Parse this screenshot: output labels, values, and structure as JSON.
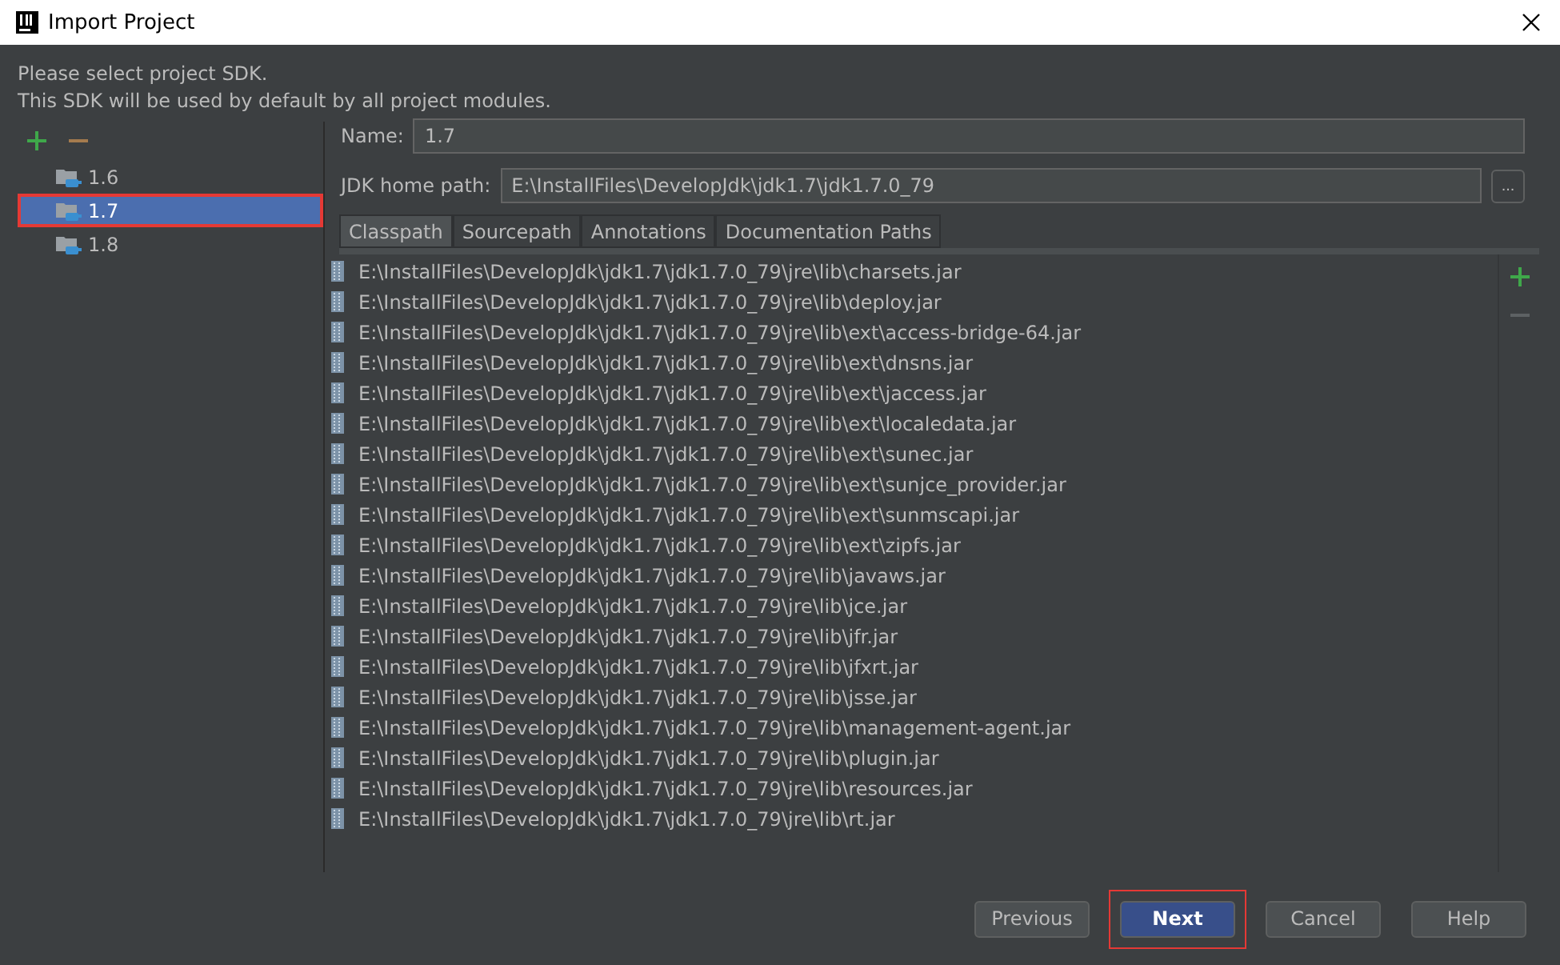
{
  "window": {
    "title": "Import Project"
  },
  "intro": [
    "Please select project SDK.",
    "This SDK will be used by default by all project modules."
  ],
  "sdk_list": [
    {
      "label": "1.6",
      "selected": false,
      "highlighted": false
    },
    {
      "label": "1.7",
      "selected": true,
      "highlighted": true
    },
    {
      "label": "1.8",
      "selected": false,
      "highlighted": false
    }
  ],
  "name_field": {
    "label": "Name:",
    "value": "1.7"
  },
  "home_path_field": {
    "label": "JDK home path:",
    "value": "E:\\InstallFiles\\DevelopJdk\\jdk1.7\\jdk1.7.0_79",
    "browse": "..."
  },
  "tabs": [
    {
      "label": "Classpath",
      "selected": true
    },
    {
      "label": "Sourcepath",
      "selected": false
    },
    {
      "label": "Annotations",
      "selected": false
    },
    {
      "label": "Documentation Paths",
      "selected": false
    }
  ],
  "classpath": [
    "E:\\InstallFiles\\DevelopJdk\\jdk1.7\\jdk1.7.0_79\\jre\\lib\\charsets.jar",
    "E:\\InstallFiles\\DevelopJdk\\jdk1.7\\jdk1.7.0_79\\jre\\lib\\deploy.jar",
    "E:\\InstallFiles\\DevelopJdk\\jdk1.7\\jdk1.7.0_79\\jre\\lib\\ext\\access-bridge-64.jar",
    "E:\\InstallFiles\\DevelopJdk\\jdk1.7\\jdk1.7.0_79\\jre\\lib\\ext\\dnsns.jar",
    "E:\\InstallFiles\\DevelopJdk\\jdk1.7\\jdk1.7.0_79\\jre\\lib\\ext\\jaccess.jar",
    "E:\\InstallFiles\\DevelopJdk\\jdk1.7\\jdk1.7.0_79\\jre\\lib\\ext\\localedata.jar",
    "E:\\InstallFiles\\DevelopJdk\\jdk1.7\\jdk1.7.0_79\\jre\\lib\\ext\\sunec.jar",
    "E:\\InstallFiles\\DevelopJdk\\jdk1.7\\jdk1.7.0_79\\jre\\lib\\ext\\sunjce_provider.jar",
    "E:\\InstallFiles\\DevelopJdk\\jdk1.7\\jdk1.7.0_79\\jre\\lib\\ext\\sunmscapi.jar",
    "E:\\InstallFiles\\DevelopJdk\\jdk1.7\\jdk1.7.0_79\\jre\\lib\\ext\\zipfs.jar",
    "E:\\InstallFiles\\DevelopJdk\\jdk1.7\\jdk1.7.0_79\\jre\\lib\\javaws.jar",
    "E:\\InstallFiles\\DevelopJdk\\jdk1.7\\jdk1.7.0_79\\jre\\lib\\jce.jar",
    "E:\\InstallFiles\\DevelopJdk\\jdk1.7\\jdk1.7.0_79\\jre\\lib\\jfr.jar",
    "E:\\InstallFiles\\DevelopJdk\\jdk1.7\\jdk1.7.0_79\\jre\\lib\\jfxrt.jar",
    "E:\\InstallFiles\\DevelopJdk\\jdk1.7\\jdk1.7.0_79\\jre\\lib\\jsse.jar",
    "E:\\InstallFiles\\DevelopJdk\\jdk1.7\\jdk1.7.0_79\\jre\\lib\\management-agent.jar",
    "E:\\InstallFiles\\DevelopJdk\\jdk1.7\\jdk1.7.0_79\\jre\\lib\\plugin.jar",
    "E:\\InstallFiles\\DevelopJdk\\jdk1.7\\jdk1.7.0_79\\jre\\lib\\resources.jar",
    "E:\\InstallFiles\\DevelopJdk\\jdk1.7\\jdk1.7.0_79\\jre\\lib\\rt.jar"
  ],
  "buttons": [
    {
      "label": "Previous",
      "kind": "normal",
      "highlighted": false
    },
    {
      "label": "Next",
      "kind": "default",
      "highlighted": true
    },
    {
      "label": "Cancel",
      "kind": "normal",
      "highlighted": false
    },
    {
      "label": "Help",
      "kind": "normal",
      "highlighted": false
    }
  ]
}
